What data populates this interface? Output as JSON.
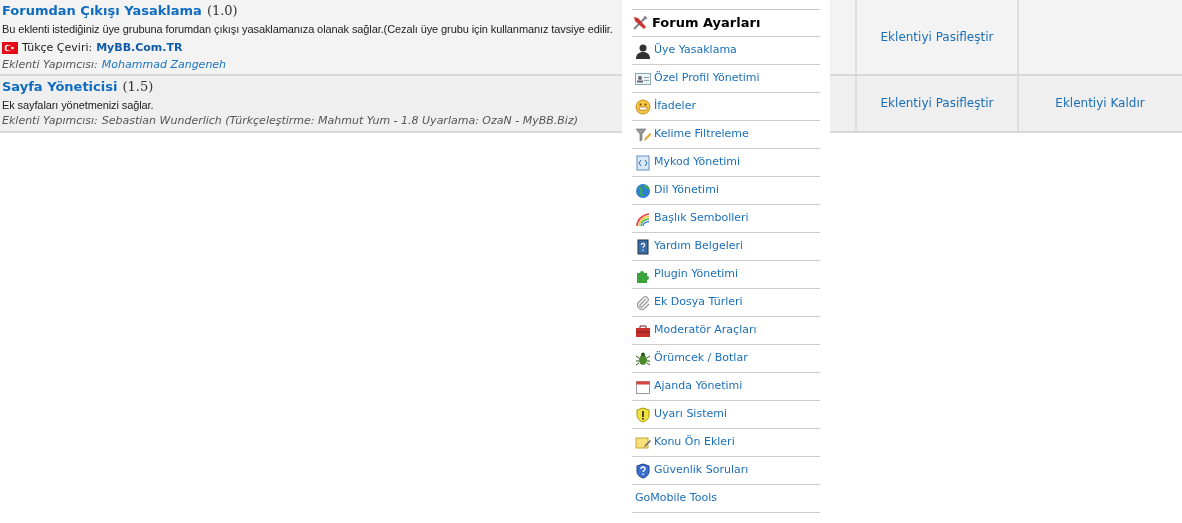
{
  "plugins": [
    {
      "title": "Forumdan Çıkışı Yasaklama",
      "version": "(1.0)",
      "description": "Bu eklenti istediğiniz üye grubuna forumdan çıkışı yasaklamanıza olanak sağlar.(Cezalı üye grubu için kullanmanız tavsiye edilir.",
      "translation": {
        "label": "Tükçe Çeviri:",
        "link": "MyBB.Com.TR"
      },
      "author_label": "Eklenti Yapımcısı:",
      "author": "Mohammad Zangeneh",
      "author_linked": true,
      "actions": [
        "Eklentiyi Pasifleştir"
      ]
    },
    {
      "title": "Sayfa Yöneticisi",
      "version": "(1.5)",
      "description": "Ek sayfaları yönetmenizi sağlar.",
      "author_label": "Eklenti Yapımcısı:",
      "author": "Sebastian Wunderlich (Türkçeleştirme: Mahmut Yum - 1.8 Uyarlama: OzaN - MyBB.Biz)",
      "author_linked": false,
      "actions": [
        "Eklentiyi Pasifleştir",
        "Eklentiyi Kaldır"
      ]
    }
  ],
  "menu": {
    "title": "Forum Ayarları",
    "items": [
      {
        "label": "Üye Yasaklama",
        "kind": "icon"
      },
      {
        "label": "Özel Profil Yönetimi",
        "kind": "icon"
      },
      {
        "label": "İfadeler",
        "kind": "icon"
      },
      {
        "label": "Kelime Filtreleme",
        "kind": "icon"
      },
      {
        "label": "Mykod Yönetimi",
        "kind": "icon"
      },
      {
        "label": "Dil Yönetimi",
        "kind": "icon"
      },
      {
        "label": "Başlık Sembolleri",
        "kind": "icon"
      },
      {
        "label": "Yardım Belgeleri",
        "kind": "icon"
      },
      {
        "label": "Plugin Yönetimi",
        "kind": "icon"
      },
      {
        "label": "Ek Dosya Türleri",
        "kind": "icon"
      },
      {
        "label": "Moderatör Araçları",
        "kind": "icon"
      },
      {
        "label": "Örümcek / Botlar",
        "kind": "icon"
      },
      {
        "label": "Ajanda Yönetimi",
        "kind": "icon"
      },
      {
        "label": "Uyarı Sistemi",
        "kind": "icon"
      },
      {
        "label": "Konu Ön Ekleri",
        "kind": "icon"
      },
      {
        "label": "Güvenlik Soruları",
        "kind": "icon"
      },
      {
        "label": "GoMobile Tools",
        "kind": "text"
      }
    ]
  }
}
